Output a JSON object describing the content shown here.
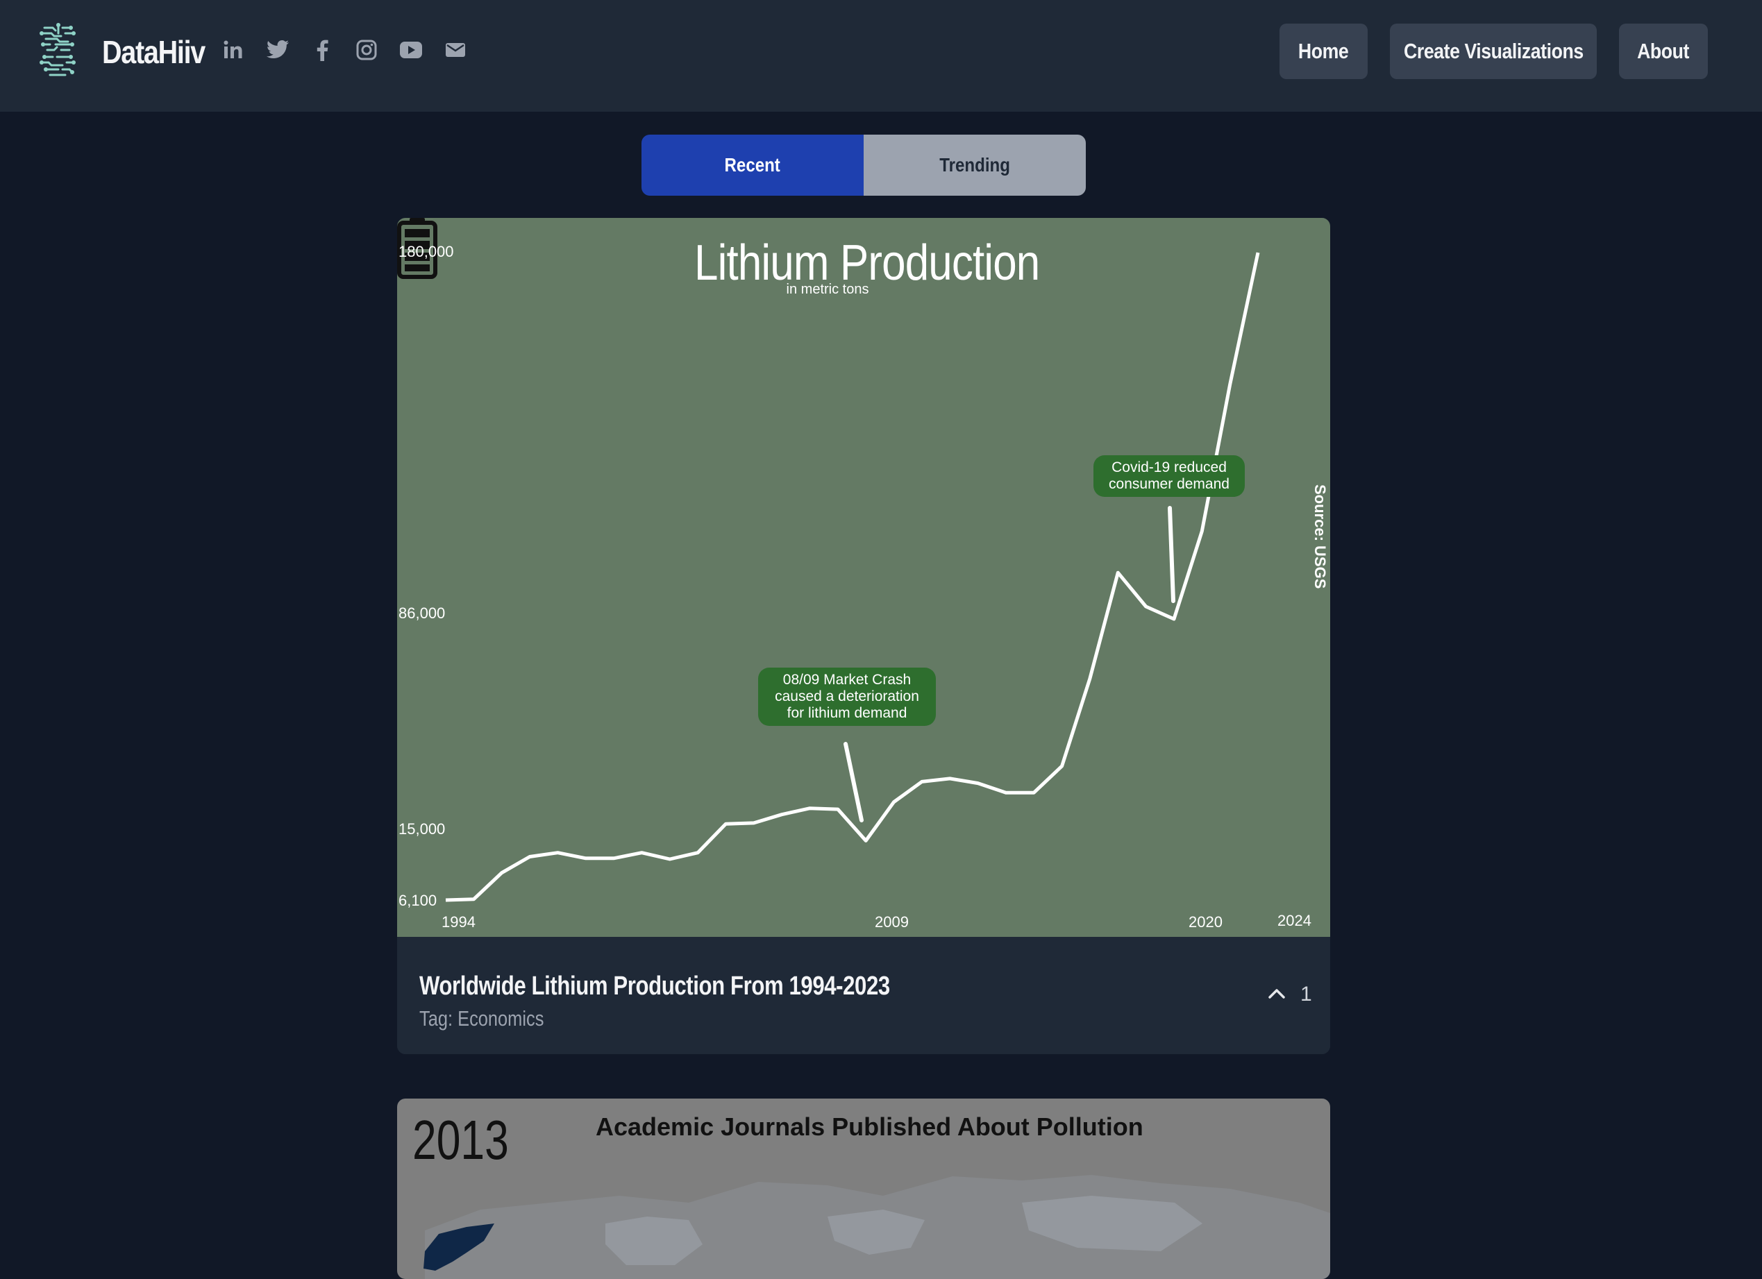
{
  "app": {
    "brand": "DataHiiv",
    "social_icons": [
      "linkedin-icon",
      "twitter-icon",
      "facebook-icon",
      "instagram-icon",
      "youtube-icon",
      "email-icon"
    ]
  },
  "nav": {
    "home": "Home",
    "create": "Create Visualizations",
    "about": "About"
  },
  "tabs": {
    "recent": "Recent",
    "trending": "Trending",
    "active": "Recent"
  },
  "colors": {
    "page_bg": "#111827",
    "header_bg": "#1f2937",
    "accent": "#1e40af",
    "chart_bg": "#647a64",
    "annotation_bg": "#2e6e2e"
  },
  "cards": [
    {
      "title": "Worldwide Lithium Production From 1994-2023",
      "tag": "Tag: Economics",
      "upvotes": "1",
      "chart": {
        "title": "Lithium Production",
        "subtitle": "in metric tons",
        "source": "Source: USGS",
        "y_tick_labels": [
          "180,000",
          "86,000",
          "15,000",
          "6,100"
        ],
        "x_tick_labels": [
          "1994",
          "2009",
          "2020",
          "2024"
        ],
        "annotations": [
          {
            "lines": [
              "08/09 Market Crash",
              "caused a deterioration",
              "for lithium demand"
            ]
          },
          {
            "lines": [
              "Covid-19 reduced",
              "consumer demand"
            ]
          }
        ]
      }
    },
    {
      "year": "2013",
      "title": "Academic Journals Published About Pollution"
    }
  ],
  "chart_data": {
    "type": "line",
    "title": "Lithium Production",
    "subtitle": "in metric tons",
    "xlabel": "",
    "ylabel": "",
    "x": [
      1994,
      1995,
      1996,
      1997,
      1998,
      1999,
      2000,
      2001,
      2002,
      2003,
      2004,
      2005,
      2006,
      2007,
      2008,
      2009,
      2010,
      2011,
      2012,
      2013,
      2014,
      2015,
      2016,
      2017,
      2018,
      2019,
      2020,
      2021,
      2022,
      2023
    ],
    "series": [
      {
        "values": [
          6100,
          6200,
          9500,
          11500,
          12000,
          11300,
          11300,
          12000,
          11200,
          12000,
          16500,
          16800,
          19500,
          21500,
          21200,
          13500,
          23500,
          30000,
          31000,
          29500,
          26500,
          26500,
          35000,
          63000,
          95000,
          86000,
          82000,
          106000,
          145000,
          180000
        ]
      }
    ],
    "y_ticks": [
      6100,
      15000,
      86000,
      180000
    ],
    "x_ticks": [
      1994,
      2009,
      2020,
      2024
    ],
    "grid": false,
    "annotations": [
      {
        "text": "08/09 Market Crash caused a deterioration for lithium demand",
        "x": 2009
      },
      {
        "text": "Covid-19 reduced consumer demand",
        "x": 2020
      }
    ]
  }
}
